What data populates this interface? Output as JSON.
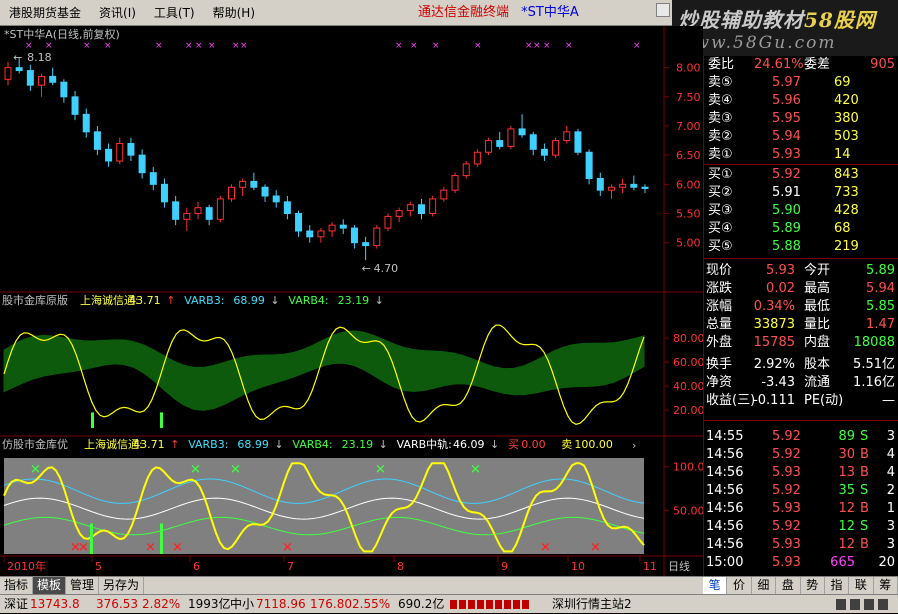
{
  "menu": [
    "港股期货基金",
    "资讯(I)",
    "工具(T)",
    "帮助(H)"
  ],
  "header": {
    "brand": "通达信金融终端",
    "stock": "*ST中华A"
  },
  "logo": {
    "line1a": "炒股辅助教材",
    "line1b": "58股网",
    "line2": "www.58Gu.com"
  },
  "main_chart": {
    "title": "*ST中华A(日线,前复权)",
    "high_label": "8.18",
    "low_label": "4.70",
    "price_ticks": [
      "8.00",
      "7.50",
      "7.00",
      "6.50",
      "6.00",
      "5.50",
      "5.00"
    ],
    "candles": [
      [
        7.8,
        8.1,
        7.7,
        8.0
      ],
      [
        8.0,
        8.18,
        7.9,
        7.95
      ],
      [
        7.95,
        8.05,
        7.6,
        7.7
      ],
      [
        7.7,
        7.9,
        7.5,
        7.85
      ],
      [
        7.85,
        8.0,
        7.7,
        7.75
      ],
      [
        7.75,
        7.8,
        7.4,
        7.5
      ],
      [
        7.5,
        7.6,
        7.1,
        7.2
      ],
      [
        7.2,
        7.3,
        6.8,
        6.9
      ],
      [
        6.9,
        7.0,
        6.5,
        6.6
      ],
      [
        6.6,
        6.7,
        6.3,
        6.4
      ],
      [
        6.4,
        6.8,
        6.35,
        6.7
      ],
      [
        6.7,
        6.8,
        6.4,
        6.5
      ],
      [
        6.5,
        6.6,
        6.1,
        6.2
      ],
      [
        6.2,
        6.3,
        5.9,
        6.0
      ],
      [
        6.0,
        6.1,
        5.6,
        5.7
      ],
      [
        5.7,
        5.8,
        5.3,
        5.4
      ],
      [
        5.4,
        5.6,
        5.2,
        5.5
      ],
      [
        5.5,
        5.7,
        5.4,
        5.6
      ],
      [
        5.6,
        5.65,
        5.3,
        5.4
      ],
      [
        5.4,
        5.8,
        5.35,
        5.75
      ],
      [
        5.75,
        6.0,
        5.7,
        5.95
      ],
      [
        5.95,
        6.1,
        5.8,
        6.05
      ],
      [
        6.05,
        6.2,
        5.9,
        5.95
      ],
      [
        5.95,
        6.0,
        5.7,
        5.8
      ],
      [
        5.8,
        5.9,
        5.6,
        5.7
      ],
      [
        5.7,
        5.8,
        5.4,
        5.5
      ],
      [
        5.5,
        5.55,
        5.1,
        5.2
      ],
      [
        5.2,
        5.3,
        5.0,
        5.1
      ],
      [
        5.1,
        5.25,
        5.0,
        5.2
      ],
      [
        5.2,
        5.35,
        5.1,
        5.3
      ],
      [
        5.3,
        5.4,
        5.15,
        5.25
      ],
      [
        5.25,
        5.3,
        4.9,
        5.0
      ],
      [
        5.0,
        5.1,
        4.7,
        4.95
      ],
      [
        4.95,
        5.3,
        4.9,
        5.25
      ],
      [
        5.25,
        5.5,
        5.2,
        5.45
      ],
      [
        5.45,
        5.6,
        5.35,
        5.55
      ],
      [
        5.55,
        5.7,
        5.45,
        5.65
      ],
      [
        5.65,
        5.75,
        5.4,
        5.5
      ],
      [
        5.5,
        5.8,
        5.45,
        5.75
      ],
      [
        5.75,
        5.95,
        5.7,
        5.9
      ],
      [
        5.9,
        6.2,
        5.85,
        6.15
      ],
      [
        6.15,
        6.4,
        6.1,
        6.35
      ],
      [
        6.35,
        6.6,
        6.3,
        6.55
      ],
      [
        6.55,
        6.8,
        6.5,
        6.75
      ],
      [
        6.75,
        6.9,
        6.6,
        6.65
      ],
      [
        6.65,
        7.0,
        6.6,
        6.95
      ],
      [
        6.95,
        7.2,
        6.8,
        6.85
      ],
      [
        6.85,
        6.9,
        6.5,
        6.6
      ],
      [
        6.6,
        6.7,
        6.4,
        6.5
      ],
      [
        6.5,
        6.8,
        6.45,
        6.75
      ],
      [
        6.75,
        7.0,
        6.7,
        6.9
      ],
      [
        6.9,
        6.95,
        6.5,
        6.55
      ],
      [
        6.55,
        6.6,
        6.0,
        6.1
      ],
      [
        6.1,
        6.2,
        5.8,
        5.9
      ],
      [
        5.9,
        6.0,
        5.75,
        5.95
      ],
      [
        5.95,
        6.1,
        5.85,
        6.0
      ],
      [
        6.0,
        6.15,
        5.9,
        5.95
      ],
      [
        5.95,
        6.0,
        5.85,
        5.93
      ]
    ]
  },
  "ind1": {
    "name": "股市金库原版",
    "items": [
      {
        "label": "上海诚信通:",
        "value": "43.71",
        "arrow": "↑"
      },
      {
        "label": "VARB3:",
        "value": "68.99",
        "arrow": "↓"
      },
      {
        "label": "VARB4:",
        "value": "23.19",
        "arrow": "↓"
      }
    ],
    "ticks": [
      "80.00",
      "60.00",
      "40.00",
      "20.00"
    ]
  },
  "ind2": {
    "name": "仿股市金库优",
    "items": [
      {
        "label": "上海诚信通:",
        "value": "43.71",
        "arrow": "↑"
      },
      {
        "label": "VARB3:",
        "value": "68.99",
        "arrow": "↓"
      },
      {
        "label": "VARB4:",
        "value": "23.19",
        "arrow": "↓"
      },
      {
        "label": "VARB中轨:",
        "value": "46.09",
        "arrow": "↓"
      },
      {
        "label": "买",
        "value": "0.00",
        "arrow": ""
      },
      {
        "label": "卖",
        "value": "100.00",
        "arrow": ""
      }
    ],
    "ticks": [
      "100.0",
      "50.00"
    ]
  },
  "xaxis": {
    "labels": [
      "2010年",
      "5",
      "6",
      "7",
      "8",
      "9",
      "10",
      "11"
    ],
    "period": "日线"
  },
  "orderbook": {
    "webi": {
      "label": "委比",
      "value": "24.61%",
      "label2": "委差",
      "value2": "905"
    },
    "sells": [
      {
        "label": "卖⑤",
        "price": "5.97",
        "vol": "69"
      },
      {
        "label": "卖④",
        "price": "5.96",
        "vol": "420"
      },
      {
        "label": "卖③",
        "price": "5.95",
        "vol": "380"
      },
      {
        "label": "卖②",
        "price": "5.94",
        "vol": "503"
      },
      {
        "label": "卖①",
        "price": "5.93",
        "vol": "14"
      }
    ],
    "buys": [
      {
        "label": "买①",
        "price": "5.92",
        "vol": "843",
        "color": "red"
      },
      {
        "label": "买②",
        "price": "5.91",
        "vol": "733",
        "color": "white"
      },
      {
        "label": "买③",
        "price": "5.90",
        "vol": "428",
        "color": "green"
      },
      {
        "label": "买④",
        "price": "5.89",
        "vol": "68",
        "color": "green"
      },
      {
        "label": "买⑤",
        "price": "5.88",
        "vol": "219",
        "color": "green"
      }
    ]
  },
  "quote": [
    {
      "l1": "现价",
      "v1": "5.93",
      "c1": "red",
      "l2": "今开",
      "v2": "5.89",
      "c2": "green"
    },
    {
      "l1": "涨跌",
      "v1": "0.02",
      "c1": "red",
      "l2": "最高",
      "v2": "5.94",
      "c2": "red"
    },
    {
      "l1": "涨幅",
      "v1": "0.34%",
      "c1": "red",
      "l2": "最低",
      "v2": "5.85",
      "c2": "green"
    },
    {
      "l1": "总量",
      "v1": "33873",
      "c1": "yellow",
      "l2": "量比",
      "v2": "1.47",
      "c2": "red"
    },
    {
      "l1": "外盘",
      "v1": "15785",
      "c1": "red",
      "l2": "内盘",
      "v2": "18088",
      "c2": "green"
    },
    {
      "l1": "换手",
      "v1": "2.92%",
      "c1": "white",
      "l2": "股本",
      "v2": "5.51亿",
      "c2": "white"
    },
    {
      "l1": "净资",
      "v1": "-3.43",
      "c1": "white",
      "l2": "流通",
      "v2": "1.16亿",
      "c2": "white"
    },
    {
      "l1": "收益(三)",
      "v1": "-0.111",
      "c1": "white",
      "l2": "PE(动)",
      "v2": "—",
      "c2": "white"
    }
  ],
  "ticks_list": [
    {
      "t": "14:55",
      "p": "5.92",
      "v": "89",
      "s": "S",
      "n": "3"
    },
    {
      "t": "14:56",
      "p": "5.92",
      "v": "30",
      "s": "B",
      "n": "4"
    },
    {
      "t": "14:56",
      "p": "5.93",
      "v": "13",
      "s": "B",
      "n": "4"
    },
    {
      "t": "14:56",
      "p": "5.92",
      "v": "35",
      "s": "S",
      "n": "2"
    },
    {
      "t": "14:56",
      "p": "5.93",
      "v": "12",
      "s": "B",
      "n": "1"
    },
    {
      "t": "14:56",
      "p": "5.92",
      "v": "12",
      "s": "S",
      "n": "3"
    },
    {
      "t": "14:56",
      "p": "5.93",
      "v": "12",
      "s": "B",
      "n": "3"
    },
    {
      "t": "15:00",
      "p": "5.93",
      "v": "665",
      "s": "",
      "n": "20"
    }
  ],
  "right_tabs": [
    "笔",
    "价",
    "细",
    "盘",
    "势",
    "指",
    "联",
    "筹"
  ],
  "left_tabs": [
    "指标",
    "模板",
    "管理",
    "另存为"
  ],
  "status": {
    "sz_label": "深证",
    "sz_val": "13743.8",
    "sz_chg": "376.53",
    "sz_pct": "2.82%",
    "sz_amt": "1993亿",
    "zx_label": "中小",
    "zx_val": "7118.96",
    "zx_chg": "176.80",
    "zx_pct": "2.55%",
    "zx_amt": "690.2亿",
    "server": "深圳行情主站2"
  },
  "colors": {
    "up": "#ff3030",
    "down": "#40d0ff",
    "band": "#0d5a0d",
    "yellow": "#ffff00",
    "grid": "#7a0000"
  }
}
